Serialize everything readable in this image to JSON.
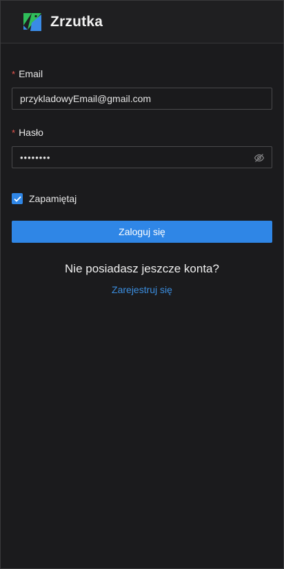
{
  "header": {
    "app_title": "Zrzutka",
    "logo_icon": "zrzutka-logo-icon",
    "colors": {
      "logo_green": "#2fbe5a",
      "logo_blue": "#3a8be6"
    }
  },
  "form": {
    "email": {
      "label": "Email",
      "required_mark": "*",
      "value": "przykladowyEmail@gmail.com"
    },
    "password": {
      "label": "Hasło",
      "required_mark": "*",
      "value_masked": "••••••••",
      "visibility_icon": "eye-slash-icon"
    },
    "remember": {
      "label": "Zapamiętaj",
      "checked": true
    },
    "login_button": "Zaloguj się",
    "no_account_text": "Nie posiadasz jeszcze konta?",
    "register_link": "Zarejestruj się"
  },
  "colors": {
    "background": "#1b1b1d",
    "accent": "#2f86e6",
    "required": "#e8564f"
  }
}
